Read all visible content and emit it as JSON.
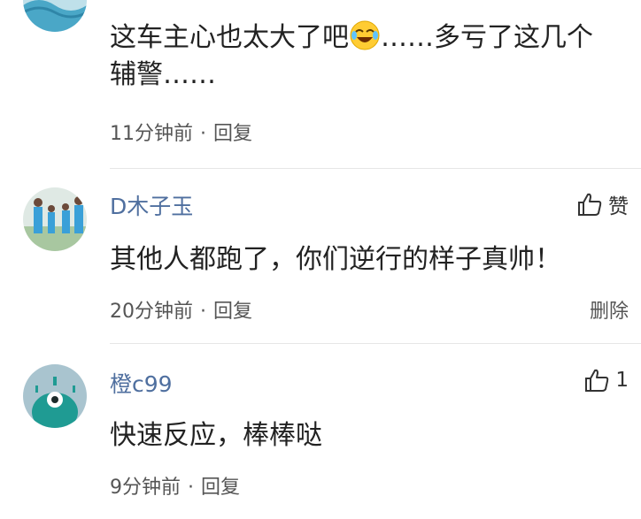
{
  "comments": [
    {
      "author": "",
      "text_before_emoji": "这车主心也太大了吧",
      "emoji": "laughing-crying-emoji",
      "text_after_emoji": "……多亏了这几个辅警……",
      "time": "11分钟前",
      "reply_label": "回复"
    },
    {
      "author": "D木子玉",
      "text": "其他人都跑了，你们逆行的样子真帅！",
      "time": "20分钟前",
      "reply_label": "回复",
      "like_label": "赞",
      "delete_label": "删除"
    },
    {
      "author": "橙c99",
      "text": "快速反应，棒棒哒",
      "time": "9分钟前",
      "reply_label": "回复",
      "like_count": "1"
    }
  ],
  "separator": "·",
  "icons": {
    "like": "thumbs-up-icon"
  }
}
